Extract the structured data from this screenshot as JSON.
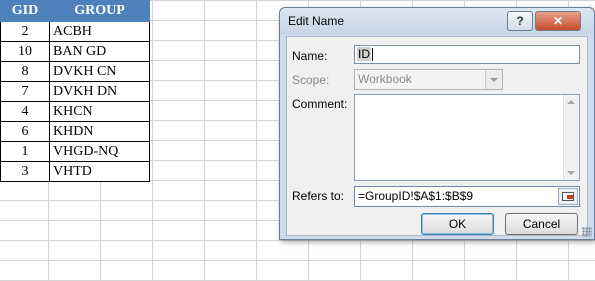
{
  "sheet": {
    "headers": {
      "gid": "GID",
      "group": "GROUP"
    },
    "rows": [
      {
        "gid": "2",
        "group": "ACBH"
      },
      {
        "gid": "10",
        "group": "BAN GD"
      },
      {
        "gid": "8",
        "group": "DVKH CN"
      },
      {
        "gid": "7",
        "group": "DVKH DN"
      },
      {
        "gid": "4",
        "group": "KHCN"
      },
      {
        "gid": "6",
        "group": "KHDN"
      },
      {
        "gid": "1",
        "group": "VHGD-NQ"
      },
      {
        "gid": "3",
        "group": "VHTD"
      }
    ],
    "header_color": "#4f81bd"
  },
  "dialog": {
    "title": "Edit Name",
    "help_glyph": "?",
    "close_glyph": "✕",
    "name_label": "Name:",
    "name_value": "ID",
    "scope_label": "Scope:",
    "scope_value": "Workbook",
    "comment_label": "Comment:",
    "comment_value": "",
    "refers_label": "Refers to:",
    "refers_value": "=GroupID!$A$1:$B$9",
    "ok_label": "OK",
    "cancel_label": "Cancel",
    "icons": {
      "help": "help-icon",
      "close": "close-icon",
      "scope_dropdown": "chevron-down-icon",
      "range_picker": "range-collapse-icon"
    },
    "colors": {
      "close_button": "#c74a2a",
      "frame": "#cfdbe9"
    }
  }
}
